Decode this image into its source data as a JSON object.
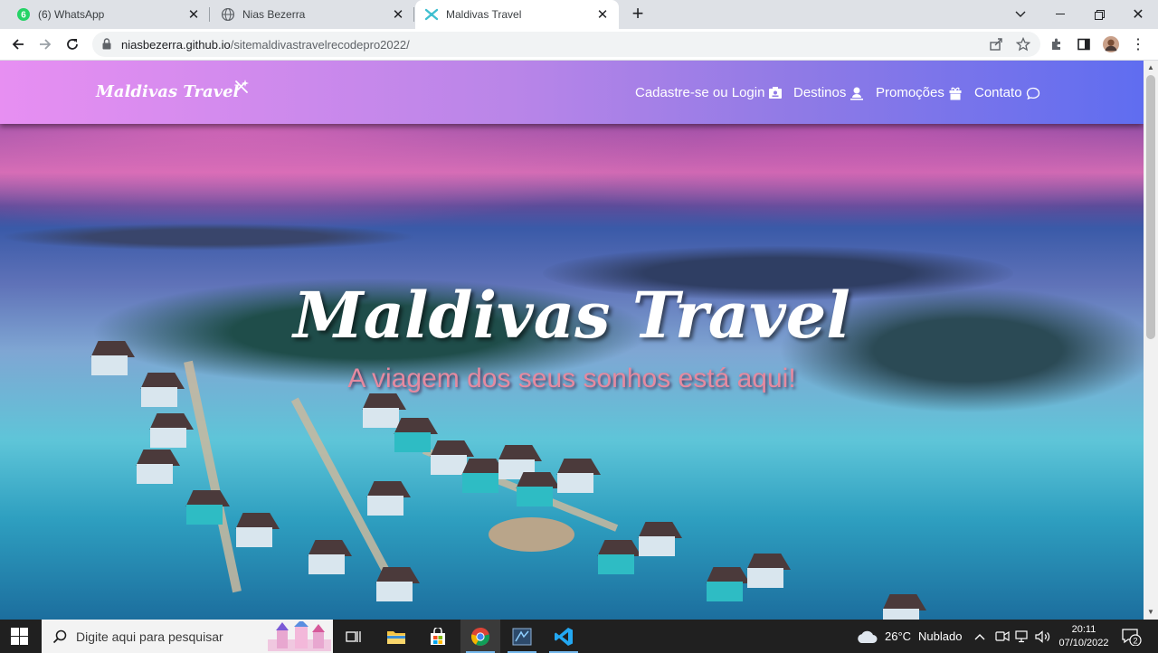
{
  "browser": {
    "tabs": [
      {
        "title": "(6) WhatsApp",
        "badge": "6",
        "icon": "whatsapp-icon"
      },
      {
        "title": "Nias Bezerra",
        "icon": "globe-icon"
      },
      {
        "title": "Maldivas Travel",
        "icon": "maldivas-favicon",
        "active": true
      }
    ],
    "url_host": "niasbezerra.github.io",
    "url_path": "/sitemaldivastravelrecodepro2022/"
  },
  "site": {
    "logo": "Maldivas Travel",
    "nav": [
      {
        "label": "Cadastre-se ou Login",
        "icon": "id-card-icon"
      },
      {
        "label": "Destinos",
        "icon": "person-pin-icon"
      },
      {
        "label": "Promoções",
        "icon": "gift-icon"
      },
      {
        "label": "Contato",
        "icon": "chat-bubble-icon"
      }
    ],
    "hero_title": "Maldivas Travel",
    "hero_subtitle": "A viagem dos seus sonhos está aqui!"
  },
  "taskbar": {
    "search_placeholder": "Digite aqui para pesquisar",
    "weather_temp": "26°C",
    "weather_desc": "Nublado",
    "time": "20:11",
    "date": "07/10/2022",
    "notifications": "2"
  },
  "colors": {
    "header_left": "#e78ff2",
    "header_right": "#5f6df0",
    "subtitle": "#e58aa0"
  }
}
